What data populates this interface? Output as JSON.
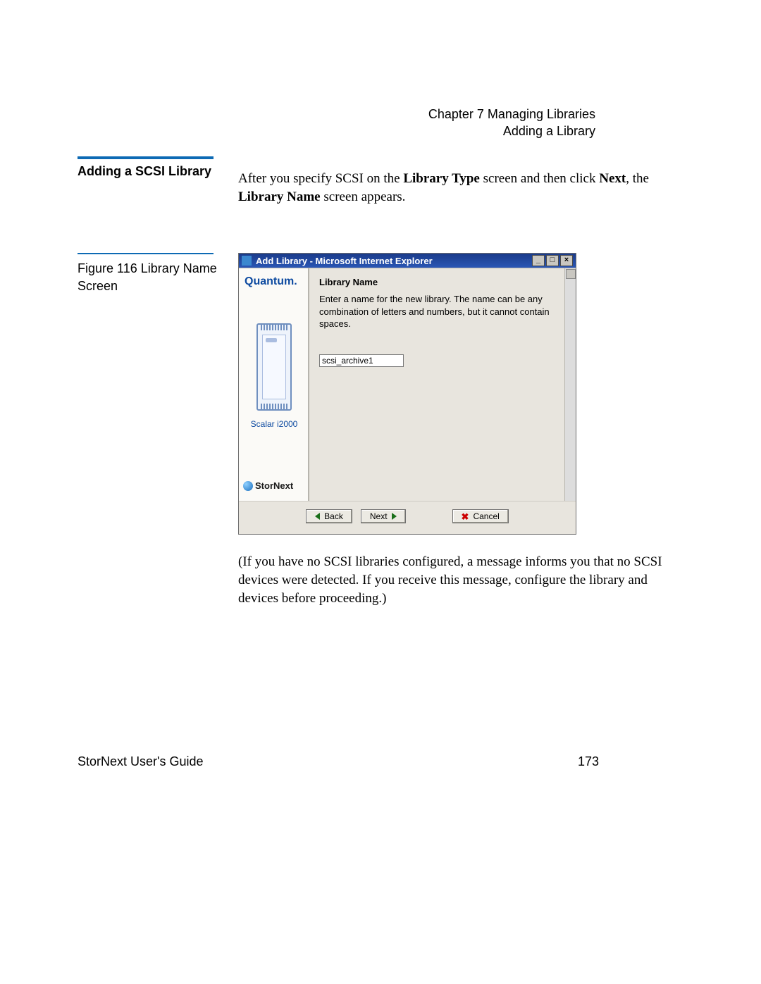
{
  "header": {
    "chapter": "Chapter 7  Managing Libraries",
    "subtitle": "Adding a Library"
  },
  "section": {
    "title": "Adding a SCSI Library"
  },
  "intro": {
    "t1": "After you specify SCSI on the ",
    "b1": "Library Type",
    "t2": " screen and then click ",
    "b2": "Next",
    "t3": ", the ",
    "b3": "Library Name",
    "t4": " screen appears."
  },
  "figure": {
    "caption": "Figure 116  Library Name Screen"
  },
  "screenshot": {
    "title": "Add Library - Microsoft Internet Explorer",
    "min": "_",
    "max": "□",
    "close": "×",
    "sidebar": {
      "brand": "Quantum.",
      "device": "Scalar i2000",
      "product": "StorNext"
    },
    "pane": {
      "heading": "Library Name",
      "instruction": "Enter a name for the new library. The name can be any combination of letters and numbers, but it cannot contain spaces.",
      "input_value": "scsi_archive1"
    },
    "buttons": {
      "back": "Back",
      "next": "Next",
      "cancel": "Cancel"
    }
  },
  "after_figure": "(If you have no SCSI libraries configured, a message informs you that no SCSI devices were detected. If you receive this message, configure the library and devices before proceeding.)",
  "footer": {
    "guide": "StorNext User's Guide",
    "page": "173"
  }
}
